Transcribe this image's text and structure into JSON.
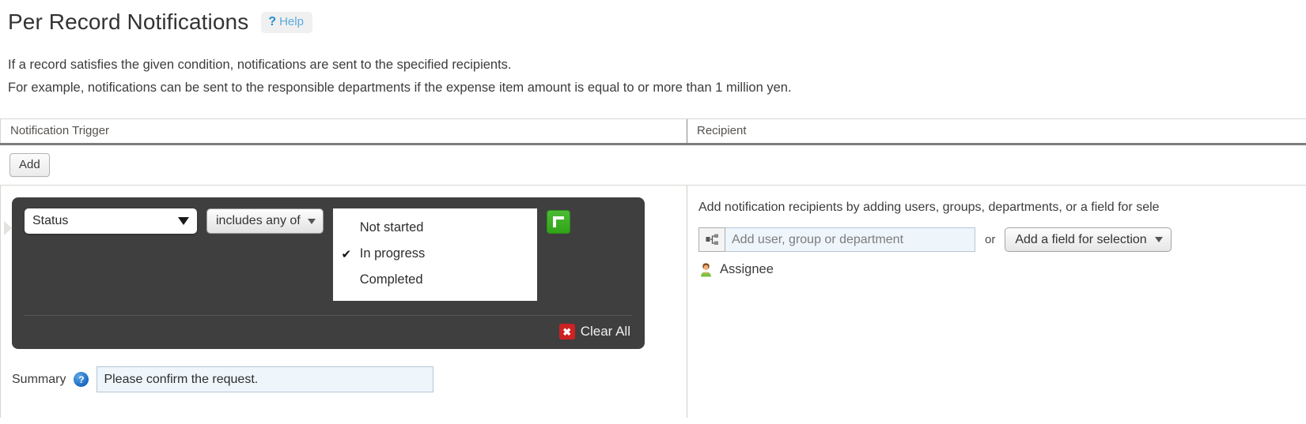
{
  "header": {
    "title": "Per Record Notifications",
    "help_mark": "?",
    "help_label": "Help"
  },
  "description": {
    "line1": "If a record satisfies the given condition, notifications are sent to the specified recipients.",
    "line2": "For example, notifications can be sent to the responsible departments if the expense item amount is equal to or more than 1 million yen."
  },
  "table": {
    "columns": {
      "trigger": "Notification Trigger",
      "recipient": "Recipient"
    },
    "add_button": "Add"
  },
  "condition": {
    "field_value": "Status",
    "operator_value": "includes any of",
    "options": [
      {
        "label": "Not started",
        "check": ""
      },
      {
        "label": "In progress",
        "check": "✔"
      },
      {
        "label": "Completed",
        "check": ""
      }
    ],
    "add_condition_icon": "plus-icon",
    "clear_all_label": "Clear All",
    "clear_all_mark": "✖"
  },
  "summary": {
    "label": "Summary",
    "help_mark": "?",
    "value": "Please confirm the request.",
    "placeholder": "Summary"
  },
  "recipient": {
    "hint": "Add notification recipients by adding users, groups, departments, or a field for sele",
    "picker_icon": "org-tree-icon",
    "picker_placeholder": "Add user, group or department",
    "or_text": "or",
    "field_select_value": "Add a field for selection",
    "items": [
      {
        "label": "Assignee",
        "icon": "user-avatar-icon"
      }
    ]
  },
  "colors": {
    "panel_dark": "#3f3f3f",
    "accent_green": "#34a91b",
    "accent_red": "#cc2222",
    "link_blue": "#5babdd",
    "input_blue": "#eef5fb"
  }
}
